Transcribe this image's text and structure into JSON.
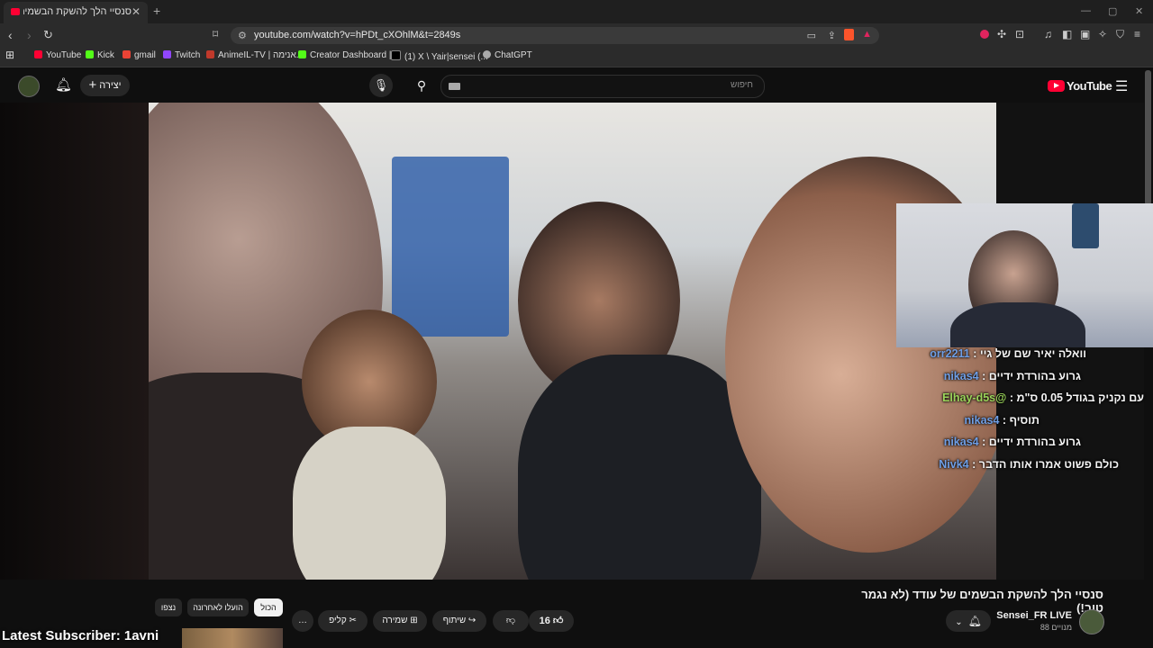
{
  "browser": {
    "tab_title": "סנסיי הלך להשקת הבשמים של...",
    "tab_close": "✕",
    "new_tab": "+",
    "url": "youtube.com/watch?v=hPDt_cXOhlM&t=2849s",
    "bookmarks": [
      "YouTube",
      "Kick",
      "gmail",
      "Twitch",
      "AnimeIL-TV | אנימה...",
      "Creator Dashboard |...",
      "(1) X \\ Yair|sensei (...",
      "ChatGPT"
    ]
  },
  "youtube": {
    "logo_text": "YouTube",
    "create_label": "יצירה",
    "search_placeholder": "חיפוש",
    "icons": [
      "avatar",
      "bell-icon",
      "plus-icon",
      "mic-icon",
      "search-icon",
      "keyboard-icon",
      "menu-icon"
    ]
  },
  "chat": [
    {
      "user": "orr2211",
      "text": "וואלה יאיר שם של גיי",
      "color": "#6f9fe6"
    },
    {
      "user": "nikas4",
      "text": "גרוע בהורדת ידיים",
      "color": "#6f9fe6"
    },
    {
      "user": "@Elhay-d5s",
      "text": "עם נקניק בגודל 0.05 ס\"מ",
      "color": "#9bd45a"
    },
    {
      "user": "nikas4",
      "text": "תוסיף",
      "color": "#6f9fe6"
    },
    {
      "user": "nikas4",
      "text": "גרוע בהורדת ידיים",
      "color": "#6f9fe6"
    },
    {
      "user": "Nivk4",
      "text": "כולם פשוט אמרו אותו הדבר",
      "color": "#6f9fe6"
    }
  ],
  "video": {
    "title": "סנסיי הלך להשקת הבשמים של עודד (לא נגמר טוב!)",
    "channel_name": "Sensei_FR LIVE",
    "channel_subs": "88 מנויים",
    "like_count": "16",
    "share_label": "שיתוף",
    "save_label": "שמירה",
    "clip_label": "קליפ",
    "more_label": "…"
  },
  "chips": [
    "הכול",
    "הועלו לאחרונה",
    "נצפו"
  ],
  "overlay": {
    "latest_subscriber": "Latest Subscriber: 1avni"
  }
}
